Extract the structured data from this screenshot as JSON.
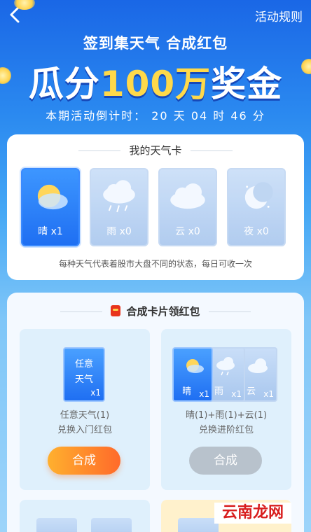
{
  "header": {
    "rules_label": "活动规则"
  },
  "hero": {
    "subtitle": "签到集天气 合成红包",
    "title_prefix": "瓜分",
    "title_highlight": "100万",
    "title_suffix": "奖金",
    "countdown_label": "本期活动倒计时：",
    "days": "20",
    "days_unit": "天",
    "hours": "04",
    "hours_unit": "时",
    "minutes": "46",
    "minutes_unit": "分"
  },
  "weather_section": {
    "title": "我的天气卡",
    "cards": [
      {
        "label": "晴 x1",
        "icon": "sun-cloud-icon",
        "active": true
      },
      {
        "label": "雨 x0",
        "icon": "rain-cloud-icon",
        "active": false
      },
      {
        "label": "云 x0",
        "icon": "cloud-icon",
        "active": false
      },
      {
        "label": "夜 x0",
        "icon": "moon-icon",
        "active": false
      }
    ],
    "note": "每种天气代表着股市大盘不同的状态，每日可收一次"
  },
  "synth_section": {
    "title": "合成卡片领红包",
    "left": {
      "card_text": "任意\n天气",
      "card_line1": "任意",
      "card_line2": "天气",
      "card_count": "x1",
      "desc_line1": "任意天气(1)",
      "desc_line2": "兑换入门红包",
      "button": "合成"
    },
    "right": {
      "cards": [
        {
          "label": "晴",
          "count": "x1"
        },
        {
          "label": "雨",
          "count": "x1"
        },
        {
          "label": "云",
          "count": "x1"
        }
      ],
      "desc_line1": "晴(1)+雨(1)+云(1)",
      "desc_line2": "兑换进阶红包",
      "button": "合成"
    }
  },
  "watermark": "云南龙网",
  "colors": {
    "accent": "#1f6ff2",
    "button_active": "#ff6a2a",
    "button_disabled": "#b8c2cc"
  }
}
